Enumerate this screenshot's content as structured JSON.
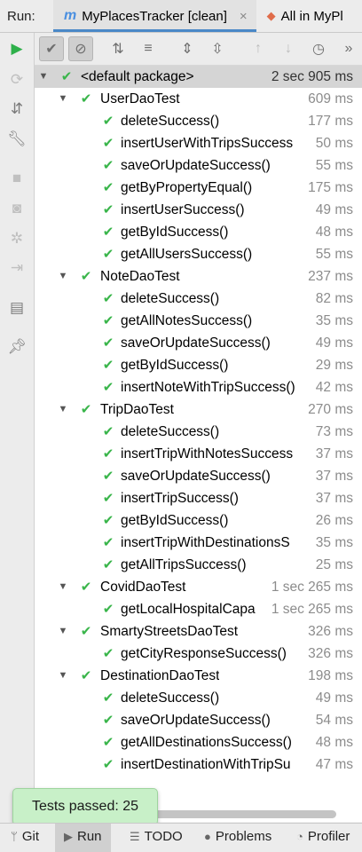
{
  "tabbar": {
    "run_label": "Run:",
    "tabs": [
      {
        "label": "MyPlacesTracker [clean]",
        "icon": "maven-icon",
        "close": "×"
      },
      {
        "label": "All in MyPl",
        "icon": "test-diamond-icon"
      }
    ]
  },
  "tree": {
    "root": {
      "label": "<default package>",
      "duration": "2 sec 905 ms"
    },
    "classes": [
      {
        "label": "UserDaoTest",
        "duration": "609 ms",
        "tests": [
          {
            "label": "deleteSuccess()",
            "duration": "177 ms"
          },
          {
            "label": "insertUserWithTripsSuccess",
            "duration": "50 ms"
          },
          {
            "label": "saveOrUpdateSuccess()",
            "duration": "55 ms"
          },
          {
            "label": "getByPropertyEqual()",
            "duration": "175 ms"
          },
          {
            "label": "insertUserSuccess()",
            "duration": "49 ms"
          },
          {
            "label": "getByIdSuccess()",
            "duration": "48 ms"
          },
          {
            "label": "getAllUsersSuccess()",
            "duration": "55 ms"
          }
        ]
      },
      {
        "label": "NoteDaoTest",
        "duration": "237 ms",
        "tests": [
          {
            "label": "deleteSuccess()",
            "duration": "82 ms"
          },
          {
            "label": "getAllNotesSuccess()",
            "duration": "35 ms"
          },
          {
            "label": "saveOrUpdateSuccess()",
            "duration": "49 ms"
          },
          {
            "label": "getByIdSuccess()",
            "duration": "29 ms"
          },
          {
            "label": "insertNoteWithTripSuccess()",
            "duration": "42 ms"
          }
        ]
      },
      {
        "label": "TripDaoTest",
        "duration": "270 ms",
        "tests": [
          {
            "label": "deleteSuccess()",
            "duration": "73 ms"
          },
          {
            "label": "insertTripWithNotesSuccess",
            "duration": "37 ms"
          },
          {
            "label": "saveOrUpdateSuccess()",
            "duration": "37 ms"
          },
          {
            "label": "insertTripSuccess()",
            "duration": "37 ms"
          },
          {
            "label": "getByIdSuccess()",
            "duration": "26 ms"
          },
          {
            "label": "insertTripWithDestinationsS",
            "duration": "35 ms"
          },
          {
            "label": "getAllTripsSuccess()",
            "duration": "25 ms"
          }
        ]
      },
      {
        "label": "CovidDaoTest",
        "duration": "1 sec 265 ms",
        "tests": [
          {
            "label": "getLocalHospitalCapa",
            "duration": "1 sec 265 ms"
          }
        ]
      },
      {
        "label": "SmartyStreetsDaoTest",
        "duration": "326 ms",
        "tests": [
          {
            "label": "getCityResponseSuccess()",
            "duration": "326 ms"
          }
        ]
      },
      {
        "label": "DestinationDaoTest",
        "duration": "198 ms",
        "tests": [
          {
            "label": "deleteSuccess()",
            "duration": "49 ms"
          },
          {
            "label": "saveOrUpdateSuccess()",
            "duration": "54 ms"
          },
          {
            "label": "getAllDestinationsSuccess()",
            "duration": "48 ms"
          },
          {
            "label": "insertDestinationWithTripSu",
            "duration": "47 ms"
          }
        ]
      }
    ]
  },
  "toast": {
    "text": "Tests passed: 25"
  },
  "bottombar": {
    "items": [
      {
        "label": "Git",
        "icon": "git-branch-icon"
      },
      {
        "label": "Run",
        "icon": "run-icon"
      },
      {
        "label": "TODO",
        "icon": "list-icon"
      },
      {
        "label": "Problems",
        "icon": "info-icon"
      },
      {
        "label": "Profiler",
        "icon": "profiler-icon"
      }
    ]
  },
  "colors": {
    "pass": "#39b54a",
    "selected_row": "#d5d5d5",
    "accent": "#4a88c7"
  }
}
